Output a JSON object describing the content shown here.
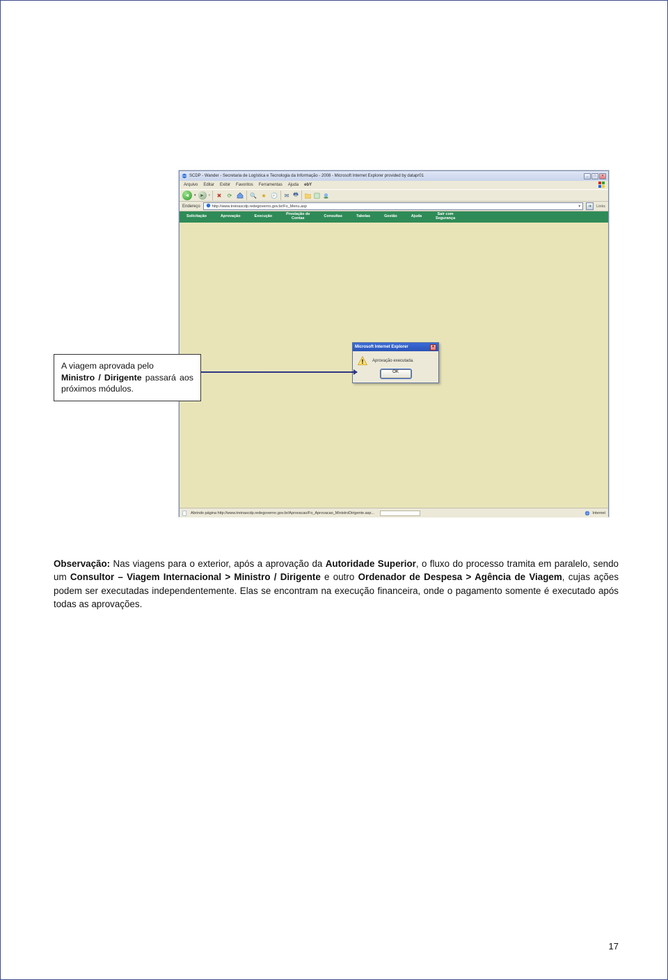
{
  "browser": {
    "title": "SCDP - Wander - Secretaria de Logística e Tecnologia da Informação - 2008 - Microsoft Internet Explorer provided by datapr01",
    "menu": {
      "arquivo": "Arquivo",
      "editar": "Editar",
      "exibir": "Exibir",
      "favoritos": "Favoritos",
      "ferramentas": "Ferramentas",
      "ajuda": "Ajuda",
      "ebay": "ebY"
    },
    "address_label": "Endereço",
    "address_url": "http://www.treinascdp.redegoverno.gov.br/Fo_Menu.asp",
    "links_label": "Links",
    "status_text": "Abrindo página http://www.treinascdp.redegoverno.gov.br/Aprovacao/Fo_Aprovacao_MinistroDirigente.asp...",
    "zone_label": "Internet"
  },
  "appmenu": {
    "items": [
      "Solicitação",
      "Aprovação",
      "Execução",
      "Prestação de\nContas",
      "Consultas",
      "Tabelas",
      "Gestão",
      "Ajuda",
      "Sair com\nSegurança"
    ]
  },
  "dialog": {
    "title": "Microsoft Internet Explorer",
    "message": "Aprovação executada.",
    "ok": "OK"
  },
  "callout": {
    "line1_a": "A viagem aprovada pelo",
    "line2_bold": "Ministro / Dirigente",
    "line2_rest": " passará aos próximos módulos."
  },
  "paragraph": {
    "lead": "Observação:",
    "t1": " Nas viagens para o exterior, após a aprovação da ",
    "b1": "Autoridade Superior",
    "t2": ", o fluxo do processo tramita em paralelo, sendo um ",
    "b2": "Consultor – Viagem Internacional > Ministro / Dirigente",
    "t3": " e outro ",
    "b3": "Ordenador de Despesa > Agência de Viagem",
    "t4": ", cujas ações podem ser executadas independentemente. Elas se encontram na execução financeira, onde o pagamento somente é executado após todas as aprovações."
  },
  "page_number": "17"
}
